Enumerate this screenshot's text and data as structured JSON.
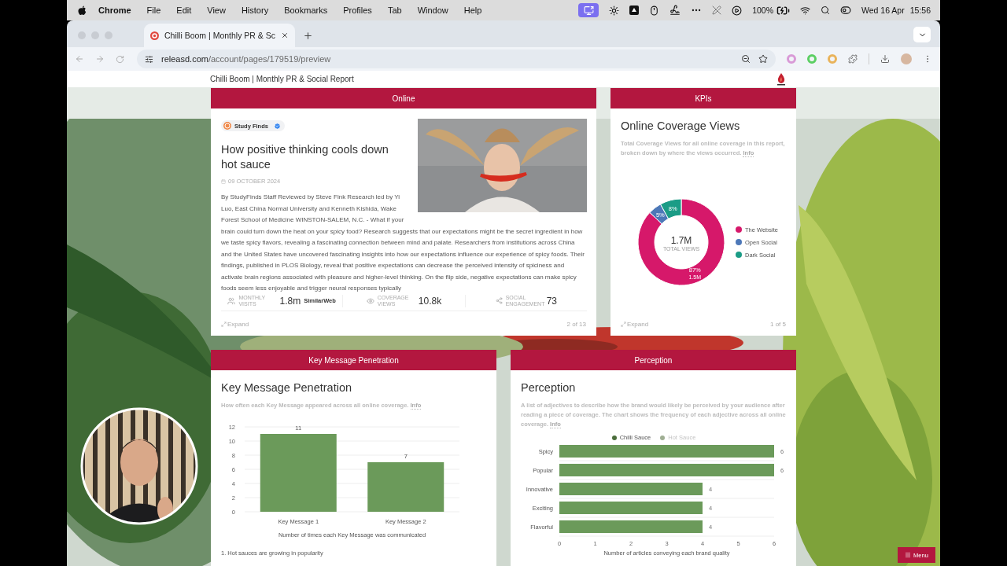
{
  "menubar": {
    "app": "Chrome",
    "items": [
      "File",
      "Edit",
      "View",
      "History",
      "Bookmarks",
      "Profiles",
      "Tab",
      "Window",
      "Help"
    ],
    "battery": "100%",
    "date": "Wed 16 Apr",
    "time": "15:56"
  },
  "browser": {
    "tab": {
      "title": "Chilli Boom | Monthly PR & Sc",
      "selected": true
    },
    "url_domain": "releasd.com",
    "url_path": "/account/pages/179519/preview"
  },
  "page": {
    "title": "Chilli Boom | Monthly PR & Social Report"
  },
  "online": {
    "header": "Online",
    "source": "Study Finds",
    "title": "How positive thinking cools down hot sauce",
    "date": "09 OCTOBER 2024",
    "body": "By StudyFinds Staff Reviewed by Steve Fink Research led by Yi Luo, East China Normal University and Kenneth Kishida, Wake Forest School of Medicine WINSTON-SALEM, N.C. - What if your brain could turn down the heat on your spicy food? Research suggests that our expectations might be the secret ingredient in how we taste spicy flavors, revealing a fascinating connection between mind and palate. Researchers from institutions across China and the United States have uncovered fascinating insights into how our expectations influence our experience of spicy foods. Their findings, published in PLOS Biology, reveal that positive expectations can decrease the perceived intensity of spiciness and activate brain regions associated with pleasure and higher-level thinking. On the flip side, negative expectations can make spicy foods seem less enjoyable and trigger neural responses typically",
    "stats": [
      {
        "kind": "visits",
        "label": "MONTHLY VISITS",
        "value": "1.8m",
        "provider": "SimilarWeb"
      },
      {
        "kind": "views",
        "label": "COVERAGE VIEWS",
        "value": "10.8k"
      },
      {
        "kind": "engagement",
        "label": "SOCIAL ENGAGEMENT",
        "value": "73"
      }
    ],
    "expand": "Expand",
    "pager": "2 of 13"
  },
  "kpis": {
    "header": "KPIs",
    "title": "Online Coverage Views",
    "description": "Total Coverage Views for all online coverage in this report, broken down by where the views occurred.",
    "info": "Info",
    "total": "1.7M",
    "website_views": "1.5M",
    "legend": [
      {
        "color": "#d6186a"
      },
      {
        "color": "#4d78b8"
      },
      {
        "color": "#1b9c86"
      }
    ],
    "chart_data": {
      "type": "donut",
      "categories": [
        "The Website",
        "Open Social",
        "Dark Social"
      ],
      "series": [
        {
          "name": "TOTAL VIEWS",
          "values": [
            87,
            5,
            8
          ]
        }
      ],
      "value_labels": [
        "87%",
        "5%",
        "8%"
      ]
    },
    "expand": "Expand",
    "pager": "1 of 5"
  },
  "key_messages": {
    "header": "Key Message Penetration",
    "title": "Key Message Penetration",
    "description": "How often each Key Message appeared across all online coverage.",
    "info": "Info",
    "chart_data": {
      "type": "bar",
      "categories": [
        "Key Message 1",
        "Key Message 2"
      ],
      "series": [
        {
          "color": "#6b9a5a",
          "values": [
            11,
            7
          ]
        }
      ],
      "xlabel": "Number of times each Key Message was communicated",
      "ylim": [
        0,
        12
      ],
      "yticks": [
        0,
        2,
        4,
        6,
        8,
        10,
        12
      ],
      "grid": true,
      "data_labels": true
    },
    "list": [
      "1.  Hot sauces are growing in popularity"
    ]
  },
  "perception": {
    "header": "Perception",
    "title": "Perception",
    "description": "A list of adjectives to describe how the brand would likely be perceived by your audience after reading a piece of coverage. The chart shows the frequency of each adjective across all online coverage.",
    "info": "Info",
    "legend": [
      {
        "label": "Chilli Sauce",
        "color": "#4b6e3c",
        "selected": true
      },
      {
        "label": "Hot Sauce",
        "color": "#9fae93",
        "selected": false
      }
    ],
    "chart_data": {
      "type": "bar",
      "orientation": "horizontal",
      "categories": [
        "Spicy",
        "Popular",
        "Innovative",
        "Exciting",
        "Flavorful"
      ],
      "series": [
        {
          "color": "#6b9a5a",
          "values": [
            6,
            6,
            4,
            4,
            4
          ]
        }
      ],
      "xlabel": "Number of articles conveying each brand quality",
      "xlim": [
        0,
        6
      ],
      "xticks": [
        0,
        1,
        2,
        3,
        4,
        5,
        6
      ],
      "grid": true,
      "data_labels": true
    }
  },
  "menu_button": "Menu"
}
